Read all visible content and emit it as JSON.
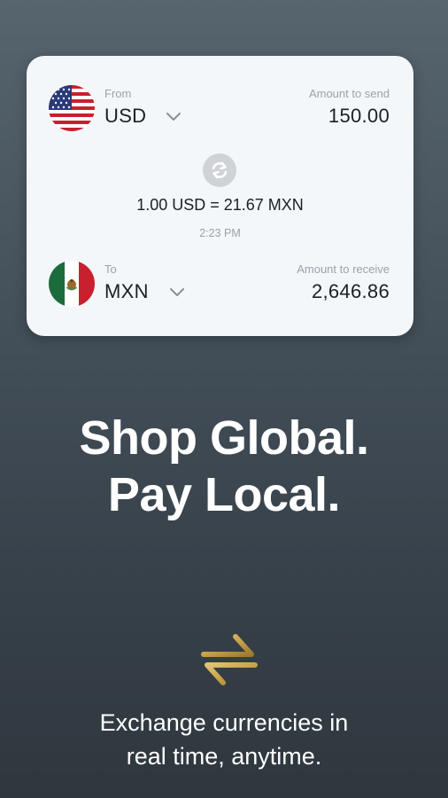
{
  "card": {
    "from": {
      "label": "From",
      "currency": "USD",
      "flag": "us-flag",
      "amount_label": "Amount to send",
      "amount": "150.00"
    },
    "to": {
      "label": "To",
      "currency": "MXN",
      "flag": "mx-flag",
      "amount_label": "Amount to receive",
      "amount": "2,646.86"
    },
    "swap_icon": "swap-icon",
    "rate": "1.00 USD = 21.67 MXN",
    "time": "2:23 PM"
  },
  "headline": {
    "line1": "Shop Global.",
    "line2": "Pay Local."
  },
  "exchange_icon": "exchange-arrows-icon",
  "tagline": {
    "line1": "Exchange currencies in",
    "line2": "real time, anytime."
  },
  "colors": {
    "accent_gold": "#c9a24a",
    "card_bg": "#f4f7fa",
    "background_top": "#57656f",
    "background_bottom": "#2f373e"
  }
}
